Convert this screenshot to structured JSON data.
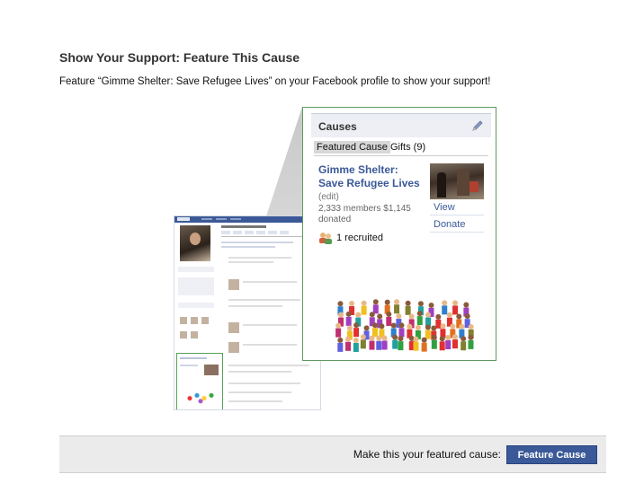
{
  "dialog": {
    "title": "Show Your Support: Feature This Cause",
    "subtitle": "Feature “Gimme Shelter: Save Refugee Lives” on your Facebook profile to show your support!"
  },
  "causes_box": {
    "header": "Causes",
    "tabs": {
      "featured": "Featured Cause",
      "gifts": "Gifts (9)"
    },
    "cause_name_line1": "Gimme Shelter:",
    "cause_name_line2": "Save Refugee Lives",
    "edit": "(edit)",
    "stats_line1": "2,333 members $1,145",
    "stats_line2": "donated",
    "view": "View",
    "donate": "Donate",
    "recruited": "1 recruited",
    "icons": [
      "pencil-icon",
      "recruits-icon"
    ]
  },
  "footer": {
    "question": "Make this your featured cause:",
    "button": "Feature Cause"
  },
  "colors": {
    "facebook_blue": "#3b5998",
    "frame_green": "#5e9a5e",
    "footer_bg": "#ebebeb"
  }
}
